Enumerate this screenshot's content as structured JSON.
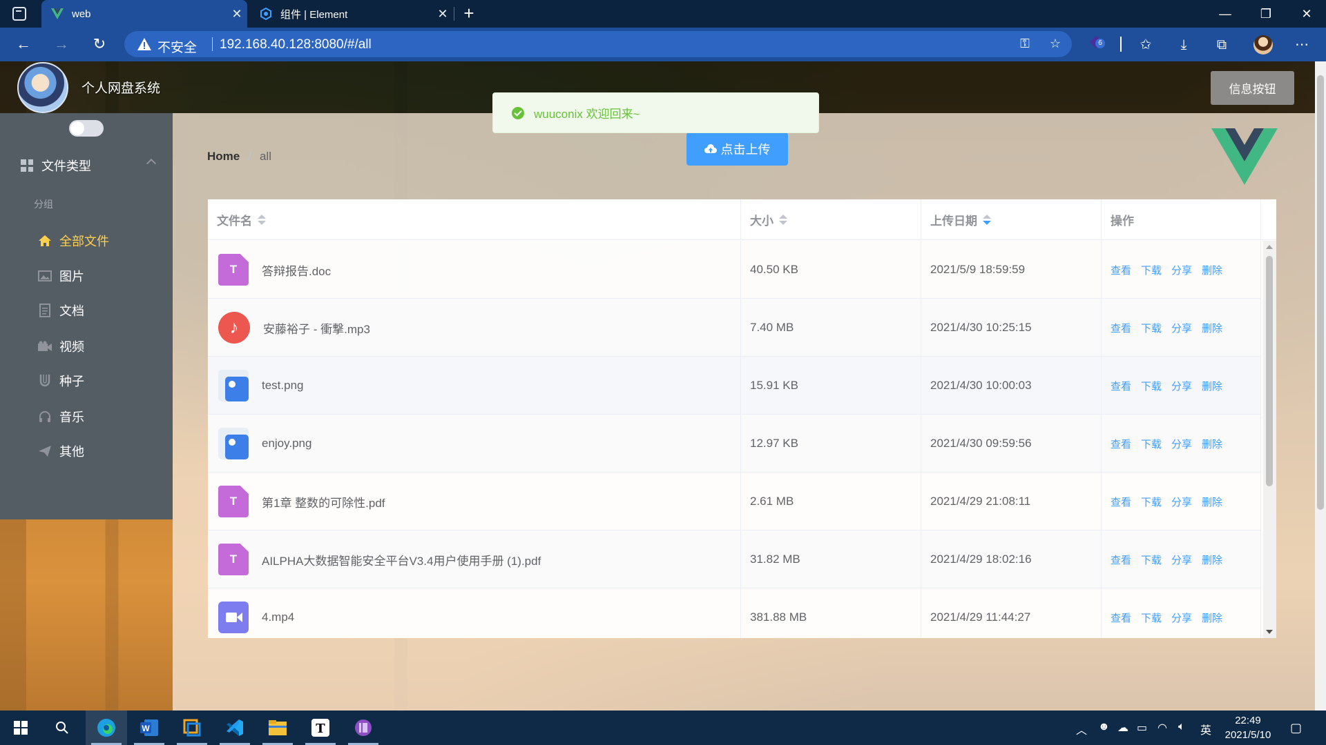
{
  "browser": {
    "tabs": [
      {
        "title": "web",
        "active": true
      },
      {
        "title": "组件 | Element",
        "active": false
      }
    ],
    "address": {
      "security_label": "不安全",
      "url": "192.168.40.128:8080/#/all"
    },
    "extension_badge": "6"
  },
  "app": {
    "site_name": "个人网盘系统",
    "info_button": "信息按钮",
    "toast_message": "wuuconix 欢迎回来~",
    "upload_button": "点击上传",
    "breadcrumb": {
      "home": "Home",
      "sep": "/",
      "current": "all"
    },
    "sidebar": {
      "submenu_title": "文件类型",
      "group_label": "分组",
      "items": [
        {
          "label": "全部文件",
          "icon": "home-icon",
          "active": true
        },
        {
          "label": "图片",
          "icon": "picture-icon",
          "active": false
        },
        {
          "label": "文档",
          "icon": "document-icon",
          "active": false
        },
        {
          "label": "视频",
          "icon": "video-camera-icon",
          "active": false
        },
        {
          "label": "种子",
          "icon": "magnet-icon",
          "active": false
        },
        {
          "label": "音乐",
          "icon": "headset-icon",
          "active": false
        },
        {
          "label": "其他",
          "icon": "send-icon",
          "active": false
        }
      ]
    },
    "table": {
      "headers": {
        "name": "文件名",
        "size": "大小",
        "date": "上传日期",
        "ops": "操作"
      },
      "sorted_column": "date",
      "rows": [
        {
          "type": "doc",
          "name": "答辩报告.doc",
          "size": "40.50 KB",
          "date": "2021/5/9 18:59:59"
        },
        {
          "type": "music",
          "name": "安藤裕子 - 衝撃.mp3",
          "size": "7.40 MB",
          "date": "2021/4/30 10:25:15"
        },
        {
          "type": "img",
          "name": "test.png",
          "size": "15.91 KB",
          "date": "2021/4/30 10:00:03"
        },
        {
          "type": "img",
          "name": "enjoy.png",
          "size": "12.97 KB",
          "date": "2021/4/30 09:59:56"
        },
        {
          "type": "doc",
          "name": "第1章 整数的可除性.pdf",
          "size": "2.61 MB",
          "date": "2021/4/29 21:08:11"
        },
        {
          "type": "doc",
          "name": "AILPHA大数据智能安全平台V3.4用户使用手册 (1).pdf",
          "size": "31.82 MB",
          "date": "2021/4/29 18:02:16"
        },
        {
          "type": "video",
          "name": "4.mp4",
          "size": "381.88 MB",
          "date": "2021/4/29 11:44:27"
        }
      ],
      "operations": [
        "查看",
        "下载",
        "分享",
        "删除"
      ]
    }
  },
  "taskbar": {
    "ime": "英",
    "time": "22:49",
    "date": "2021/5/10"
  },
  "colors": {
    "accent": "#409eff",
    "sidebar_bg": "#545c64",
    "active_menu": "#ffd04b",
    "success": "#67c23a",
    "browser_chrome": "#1f4f9a"
  }
}
